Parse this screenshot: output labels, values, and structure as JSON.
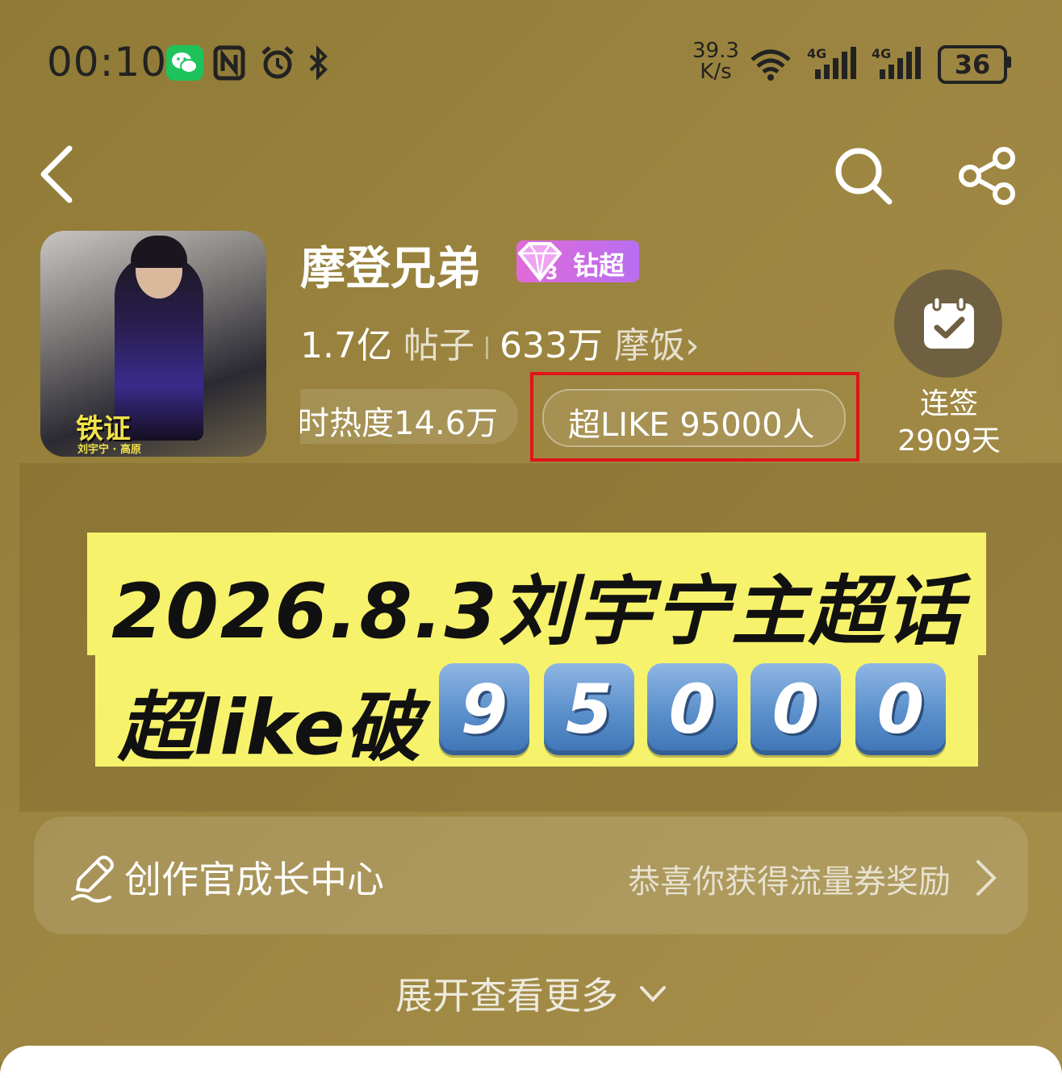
{
  "status_bar": {
    "time": "00:10",
    "net_speed_value": "39.3",
    "net_speed_unit": "K/s",
    "battery": "36",
    "icons": [
      "wechat-icon",
      "nfc-icon",
      "alarm-icon",
      "bluetooth-icon",
      "wifi-icon",
      "signal-4g-icon",
      "signal-4g-icon",
      "battery-icon"
    ]
  },
  "nav": {
    "icons": [
      "back-icon",
      "search-icon",
      "share-icon"
    ]
  },
  "topic": {
    "title": "摩登兄弟",
    "badge_label": "钻超",
    "badge_level": "3",
    "posts_count": "1.7亿",
    "posts_unit": "帖子",
    "fans_count": "633万",
    "fans_unit": "摩饭",
    "fans_chevron": "›",
    "heat_text": "时热度14.6万",
    "super_like_text": "超LIKE 95000人",
    "cover_title": "铁证",
    "cover_subtitle": "刘宇宁 · 高原"
  },
  "checkin": {
    "label": "连签",
    "days": "2909天"
  },
  "banner": {
    "line1": "2026.8.3刘宇宁主超话",
    "line2_prefix": "超like破",
    "digits": [
      "9",
      "5",
      "0",
      "0",
      "0"
    ],
    "colors": {
      "background": "#f7f26b",
      "digit": "#5a8fcb"
    }
  },
  "creator_center": {
    "title": "创作官成长中心",
    "reward_text": "恭喜你获得流量券奖励"
  },
  "expand": {
    "label": "展开查看更多"
  },
  "colors": {
    "background": "#9c8540",
    "highlight_box": "#e0141a",
    "badge": "#c66ee6"
  }
}
